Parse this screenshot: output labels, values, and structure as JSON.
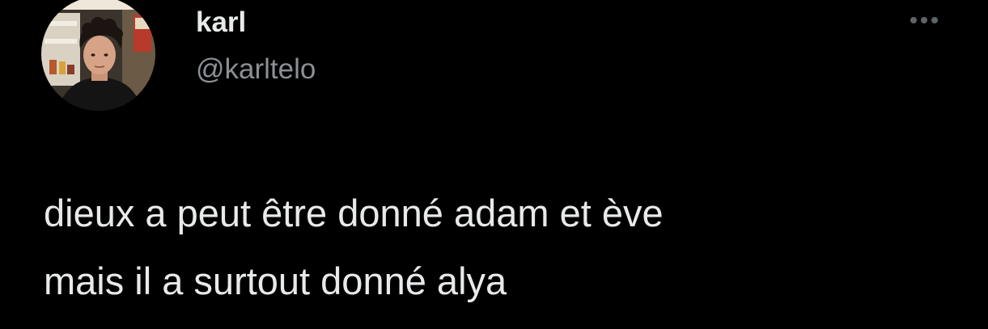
{
  "tweet": {
    "author": {
      "display_name": "karl",
      "handle": "@karltelo",
      "avatar_icon": "profile-photo"
    },
    "more_icon": "more-horizontal-icon",
    "text_lines": [
      "dieux a peut être donné adam et ève",
      "mais il a surtout donné alya"
    ]
  },
  "colors": {
    "background": "#000000",
    "primary_text": "#e7e9ea",
    "secondary_text": "#8b9096",
    "icon": "#5f6469"
  }
}
